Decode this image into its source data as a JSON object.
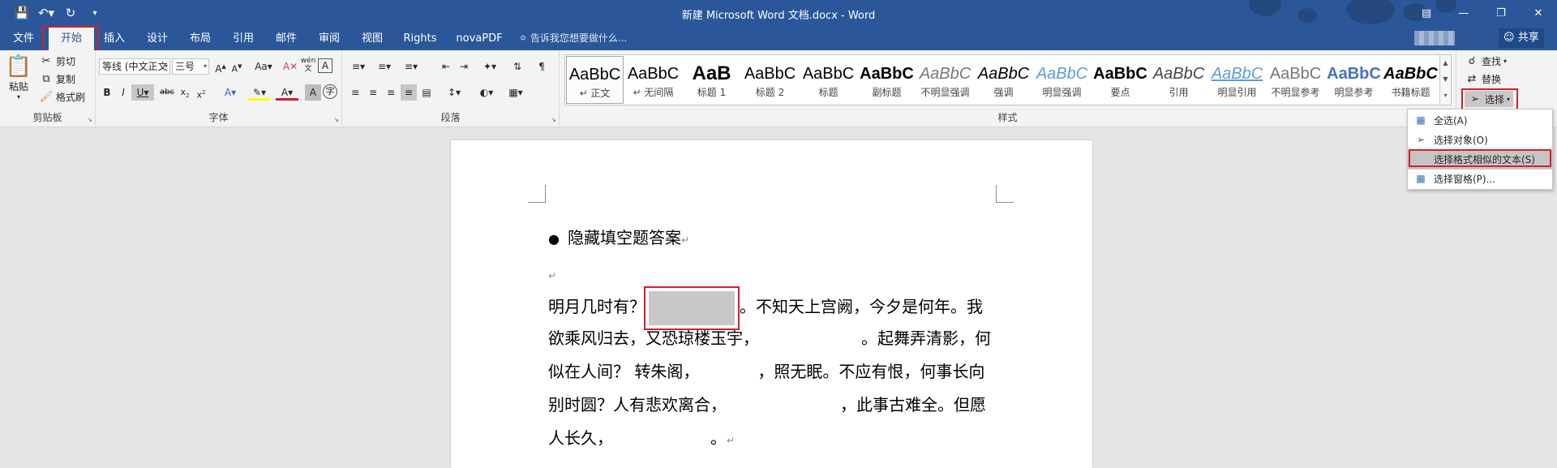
{
  "window": {
    "title": "新建 Microsoft Word 文档.docx - Word",
    "qat": {
      "save_icon": "save-icon",
      "undo_icon": "undo-icon",
      "redo_icon": "redo-icon",
      "customize_icon": "customize-icon"
    },
    "controls": {
      "ribbon_display": "ribbon-display-icon",
      "minimize": "minimize-icon",
      "restore": "restore-icon",
      "close": "close-icon"
    }
  },
  "tabs": [
    {
      "label": "文件"
    },
    {
      "label": "开始"
    },
    {
      "label": "插入"
    },
    {
      "label": "设计"
    },
    {
      "label": "布局"
    },
    {
      "label": "引用"
    },
    {
      "label": "邮件"
    },
    {
      "label": "审阅"
    },
    {
      "label": "视图"
    },
    {
      "label": "Rights"
    },
    {
      "label": "novaPDF"
    }
  ],
  "tell_me": "告诉我您想要做什么...",
  "share": "共享",
  "ribbon": {
    "clipboard": {
      "label": "剪贴板",
      "paste": "粘贴",
      "cut": "剪切",
      "copy": "复制",
      "format_painter": "格式刷"
    },
    "font": {
      "label": "字体",
      "font_name": "等线 (中文正文",
      "font_size": "三号"
    },
    "paragraph": {
      "label": "段落"
    },
    "styles": {
      "label": "样式",
      "items": [
        {
          "sample": "AaBbC",
          "name": "↵ 正文"
        },
        {
          "sample": "AaBbC",
          "name": "↵ 无间隔"
        },
        {
          "sample": "AaB",
          "name": "标题 1"
        },
        {
          "sample": "AaBbC",
          "name": "标题 2"
        },
        {
          "sample": "AaBbC",
          "name": "标题"
        },
        {
          "sample": "AaBbC",
          "name": "副标题"
        },
        {
          "sample": "AaBbC",
          "name": "不明显强调"
        },
        {
          "sample": "AaBbC",
          "name": "强调"
        },
        {
          "sample": "AaBbC",
          "name": "明显强调"
        },
        {
          "sample": "AaBbC",
          "name": "要点"
        },
        {
          "sample": "AaBbC",
          "name": "引用"
        },
        {
          "sample": "AaBbC",
          "name": "明显引用"
        },
        {
          "sample": "AaBbC",
          "name": "不明显参考"
        },
        {
          "sample": "AaBbC",
          "name": "明显参考"
        },
        {
          "sample": "AaBbC",
          "name": "书籍标题"
        }
      ]
    },
    "editing": {
      "find": "查找",
      "replace": "替换",
      "select": "选择"
    }
  },
  "select_menu": {
    "items": [
      {
        "label": "全选(A)"
      },
      {
        "label": "选择对象(O)"
      },
      {
        "label": "选择格式相似的文本(S)"
      },
      {
        "label": "选择窗格(P)..."
      }
    ]
  },
  "document": {
    "bullet_heading": "隐藏填空题答案",
    "line1_before": "明月几时有？",
    "line1_after": "。不知天上宫阙，今夕是何年。我",
    "line2_before": "欲乘风归去，又恐琼楼玉宇，",
    "line2_after": "。起舞弄清影，何",
    "line3_before": "似在人间？ 转朱阁，",
    "line3_after": "，照无眠。不应有恨，何事长向",
    "line4_before": "别时圆？人有悲欢离合，",
    "line4_after": "，此事古难全。但愿",
    "line5_before": "人长久，",
    "line5_after": "。",
    "para_mark": "↵"
  },
  "colors": {
    "accent": "#2b579a",
    "highlight_red": "#d0202d"
  }
}
